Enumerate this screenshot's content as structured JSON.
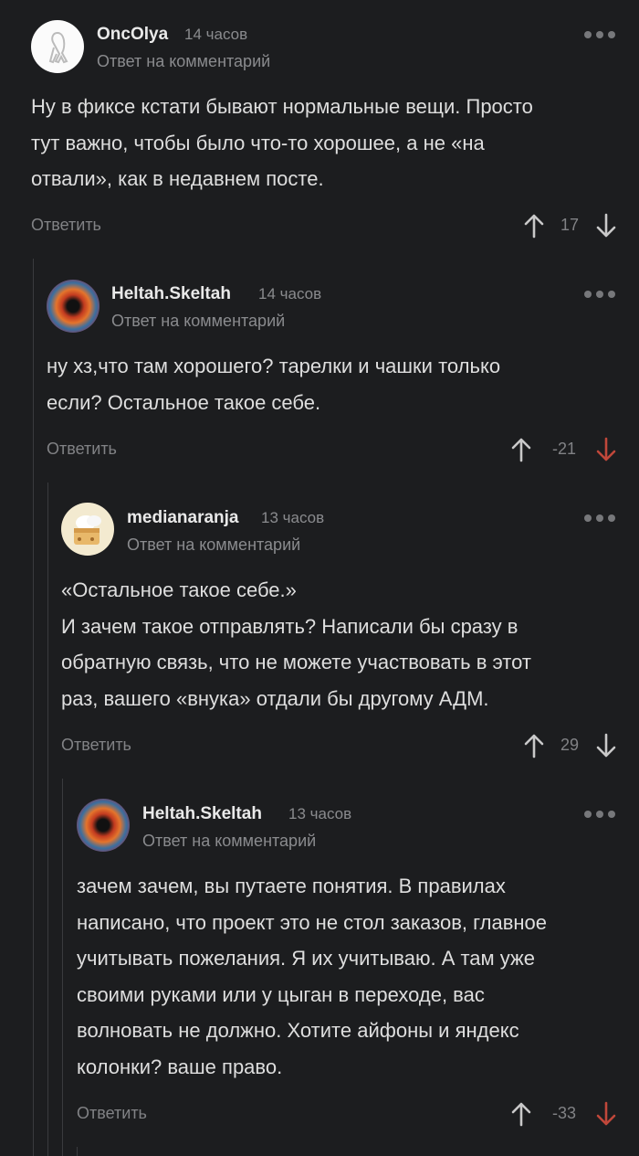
{
  "comments": [
    {
      "username": "OncOlya",
      "time": "14 часов",
      "reply_to": "Ответ на комментарий",
      "text_lines": [
        "Ну в фиксе кстати бывают нормальные вещи. Просто",
        "тут важно, чтобы было что-то хорошее, а не «на",
        "отвали», как в недавнем посте."
      ],
      "reply_label": "Ответить",
      "score": "17",
      "vote": "none"
    },
    {
      "username": "Heltah.Skeltah",
      "time": "14 часов",
      "reply_to": "Ответ на комментарий",
      "text_lines": [
        "ну хз,что там хорошего? тарелки и чашки только",
        "если? Остальное такое себе."
      ],
      "reply_label": "Ответить",
      "score": "-21",
      "vote": "down"
    },
    {
      "username": "medianaranja",
      "time": "13 часов",
      "reply_to": "Ответ на комментарий",
      "text_lines": [
        "«Остальное такое себе.»",
        "И зачем такое отправлять? Написали бы сразу в",
        "обратную связь, что не можете участвовать в этот",
        "раз, вашего «внука» отдали бы другому АДМ."
      ],
      "reply_label": "Ответить",
      "score": "29",
      "vote": "none"
    },
    {
      "username": "Heltah.Skeltah",
      "time": "13 часов",
      "reply_to": "Ответ на комментарий",
      "text_lines": [
        "зачем зачем, вы путаете понятия. В правилах",
        "написано, что проект это не стол заказов, главное",
        "учитывать пожелания. Я их учитываю. А там уже",
        "своими руками или у цыган в переходе, вас",
        "волновать не должно. Хотите айфоны и яндекс",
        "колонки? ваше право."
      ],
      "reply_label": "Ответить",
      "score": "-33",
      "vote": "down"
    }
  ],
  "colors": {
    "background": "#1c1d1f",
    "downvote_active": "#c0473a",
    "muted": "#818285"
  },
  "icons": {
    "avatar_1": "ribbon-avatar",
    "avatar_2": "swirl-avatar",
    "avatar_3": "cake-avatar",
    "more": "more-dots-icon",
    "upvote": "arrow-up-icon",
    "downvote": "arrow-down-icon"
  }
}
